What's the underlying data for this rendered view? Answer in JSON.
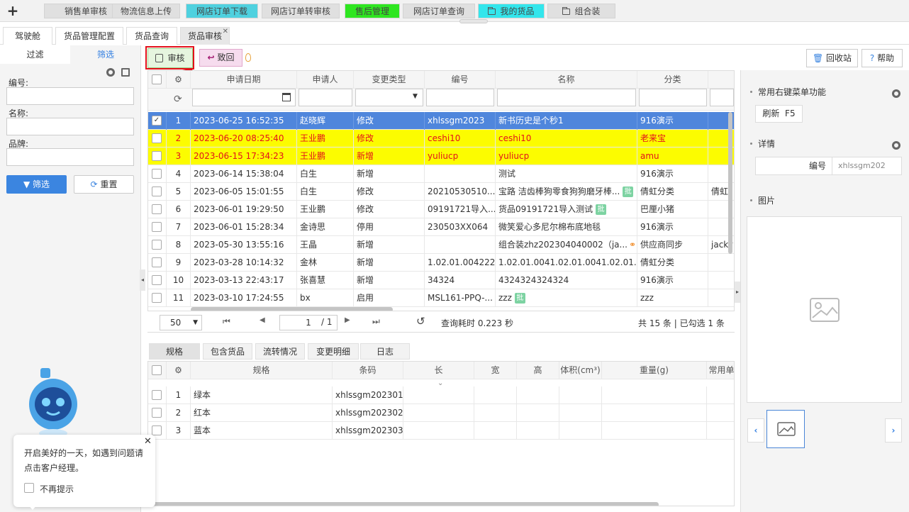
{
  "top_tabs": [
    {
      "label": "销售单审核",
      "color": "#e0e0e0",
      "folder": false
    },
    {
      "label": "物流信息上传",
      "color": "#e0e0e0",
      "folder": false
    },
    {
      "label": "网店订单下载",
      "color": "#4fd1df",
      "folder": false
    },
    {
      "label": "网店订单转审核",
      "color": "#e0e0e0",
      "folder": false
    },
    {
      "label": "售后管理",
      "color": "#2ee620",
      "folder": false
    },
    {
      "label": "网店订单查询",
      "color": "#e0e0e0",
      "folder": false
    },
    {
      "label": "我的货品",
      "color": "#33e6ec",
      "folder": true
    },
    {
      "label": "组合装",
      "color": "#e0e0e0",
      "folder": true
    }
  ],
  "sub_tabs": [
    {
      "label": "驾驶舱"
    },
    {
      "label": "货品管理配置"
    },
    {
      "label": "货品查询"
    },
    {
      "label": "货品审核",
      "active": true
    }
  ],
  "left": {
    "tab_filter": "过滤",
    "tab_screen": "筛选",
    "fields": [
      {
        "label": "编号:",
        "value": ""
      },
      {
        "label": "名称:",
        "value": ""
      },
      {
        "label": "品牌:",
        "value": ""
      }
    ],
    "filter_btn": "筛选",
    "reset_btn": "重置"
  },
  "toolbar": {
    "audit": "审核",
    "reject": "致回",
    "recycle": "回收站",
    "help": "帮助"
  },
  "grid": {
    "columns": [
      "申请日期",
      "申请人",
      "变更类型",
      "编号",
      "名称",
      "分类"
    ],
    "rows": [
      {
        "no": "1",
        "date": "2023-06-25 16:52:35",
        "user": "赵晓辉",
        "type": "修改",
        "code": "xhlssgm2023",
        "name": "新书历史是个秒1",
        "cat": "916演示",
        "extra": "",
        "badge": "",
        "state": "sel",
        "checked": true
      },
      {
        "no": "2",
        "date": "2023-06-20 08:25:40",
        "user": "王业鹏",
        "type": "修改",
        "code": "ceshi10",
        "name": "ceshi10",
        "cat": "老来宝",
        "extra": "",
        "badge": "",
        "state": "hl"
      },
      {
        "no": "3",
        "date": "2023-06-15 17:34:23",
        "user": "王业鹏",
        "type": "新增",
        "code": "yuliucp",
        "name": "yuliucp",
        "cat": "amu",
        "extra": "",
        "badge": "",
        "state": "hl"
      },
      {
        "no": "4",
        "date": "2023-06-14 15:38:04",
        "user": "白生",
        "type": "新增",
        "code": "",
        "name": "测试",
        "cat": "916演示",
        "extra": "",
        "badge": ""
      },
      {
        "no": "5",
        "date": "2023-06-05 15:01:55",
        "user": "白生",
        "type": "修改",
        "code": "20210530510...",
        "name": "宝路 洁齿棒狗零食狗狗磨牙棒...",
        "cat": "倩虹分类",
        "extra": "倩虹",
        "badge": "批"
      },
      {
        "no": "6",
        "date": "2023-06-01 19:29:50",
        "user": "王业鹏",
        "type": "修改",
        "code": "09191721导入...",
        "name": "货品09191721导入测试",
        "cat": "巴厘小猪",
        "extra": "",
        "badge": "批"
      },
      {
        "no": "7",
        "date": "2023-06-01 15:28:34",
        "user": "金诗思",
        "type": "停用",
        "code": "230503XX064",
        "name": "微笑爱心多尼尔棉布底地毯",
        "cat": "916演示",
        "extra": "",
        "badge": ""
      },
      {
        "no": "8",
        "date": "2023-05-30 13:55:16",
        "user": "王晶",
        "type": "新增",
        "code": "",
        "name": "组合装zhz202304040002（ja...",
        "cat": "供应商同步",
        "extra": "jacky",
        "badge": "",
        "combo": true
      },
      {
        "no": "9",
        "date": "2023-03-28 10:14:32",
        "user": "金林",
        "type": "新增",
        "code": "1.02.01.004222",
        "name": "1.02.01.0041.02.01.0041.02.01.0...",
        "cat": "倩虹分类",
        "extra": "",
        "badge": ""
      },
      {
        "no": "10",
        "date": "2023-03-13 22:43:17",
        "user": "张喜慧",
        "type": "新增",
        "code": "34324",
        "name": "4324324324324",
        "cat": "916演示",
        "extra": "",
        "badge": ""
      },
      {
        "no": "11",
        "date": "2023-03-10 17:24:55",
        "user": "bx",
        "type": "启用",
        "code": "MSL161-PPQ-...",
        "name": "zzz",
        "cat": "zzz",
        "extra": "",
        "badge": "批"
      }
    ]
  },
  "pager": {
    "page_size": "50",
    "page": "1",
    "total_pages": "/ 1",
    "query_time": "查询耗时 0.223 秒",
    "summary": "共 15 条 | 已勾选 1 条"
  },
  "bottom_tabs": [
    {
      "label": "规格",
      "active": true
    },
    {
      "label": "包含货品"
    },
    {
      "label": "流转情况"
    },
    {
      "label": "变更明细"
    },
    {
      "label": "日志"
    }
  ],
  "bottom_grid": {
    "columns": [
      "规格",
      "条码",
      "长",
      "宽",
      "高",
      "体积(cm³)",
      "重量(g)",
      "常用单"
    ],
    "rows": [
      {
        "no": "1",
        "spec": "绿本",
        "barcode": "xhlssgm202301"
      },
      {
        "no": "2",
        "spec": "红本",
        "barcode": "xhlssgm202302"
      },
      {
        "no": "3",
        "spec": "蓝本",
        "barcode": "xhlssgm202303"
      }
    ]
  },
  "right": {
    "menu_title": "常用右键菜单功能",
    "refresh_btn": "刷新  F5",
    "detail_title": "详情",
    "detail_key": "编号",
    "detail_value": "xhlssgm202",
    "image_title": "图片"
  },
  "tip": {
    "text1": "开启美好的一天，如遇到问题请",
    "text2": "点击客户经理。",
    "checkbox": "不再提示"
  }
}
